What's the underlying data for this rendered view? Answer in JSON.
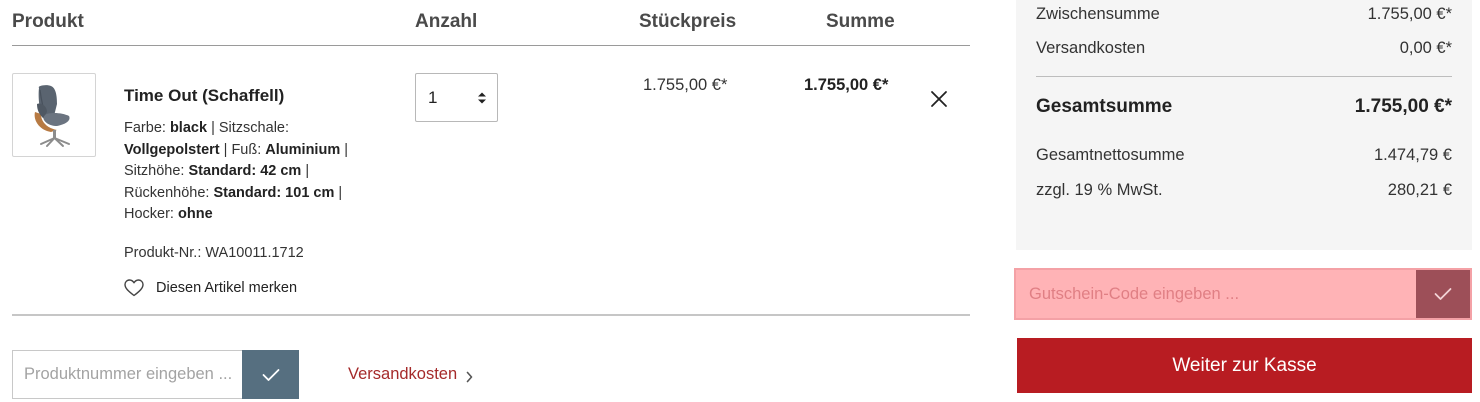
{
  "cart": {
    "headers": {
      "product": "Produkt",
      "quantity": "Anzahl",
      "unit_price": "Stückpreis",
      "sum": "Summe"
    },
    "item": {
      "title": "Time Out (Schaffell)",
      "attributes": [
        {
          "label": "Farbe:",
          "value": "black"
        },
        {
          "label": "Sitzschale:",
          "value": "Vollgepolstert"
        },
        {
          "label": "Fuß:",
          "value": "Aluminium"
        },
        {
          "label": "Sitzhöhe:",
          "value": "Standard: 42 cm"
        },
        {
          "label": "Rückenhöhe:",
          "value": "Standard: 101 cm"
        },
        {
          "label": "Hocker:",
          "value": "ohne"
        }
      ],
      "separator": "|",
      "product_number": "Produkt-Nr.: WA10011.1712",
      "wishlist_label": "Diesen Artikel merken",
      "quantity": "1",
      "unit_price": "1.755,00 €*",
      "total_price": "1.755,00 €*",
      "image_icon": "armchair-image"
    },
    "product_number_input": {
      "placeholder": "Produktnummer eingeben ..."
    },
    "shipping_link": "Versandkosten"
  },
  "summary": {
    "subtotal_label": "Zwischensumme",
    "subtotal_value": "1.755,00 €*",
    "shipping_label": "Versandkosten",
    "shipping_value": "0,00 €*",
    "total_label": "Gesamtsumme",
    "total_value": "1.755,00 €*",
    "net_label": "Gesamtnettosumme",
    "net_value": "1.474,79 €",
    "vat_label": "zzgl. 19 % MwSt.",
    "vat_value": "280,21 €"
  },
  "voucher": {
    "placeholder": "Gutschein-Code eingeben ..."
  },
  "checkout_label": "Weiter zur Kasse",
  "colors": {
    "accent_red": "#b81c22",
    "voucher_highlight": "#ffb3b6",
    "voucher_button": "#9d4f58",
    "product_number_button": "#566f80",
    "link_red": "#a52a2a"
  }
}
